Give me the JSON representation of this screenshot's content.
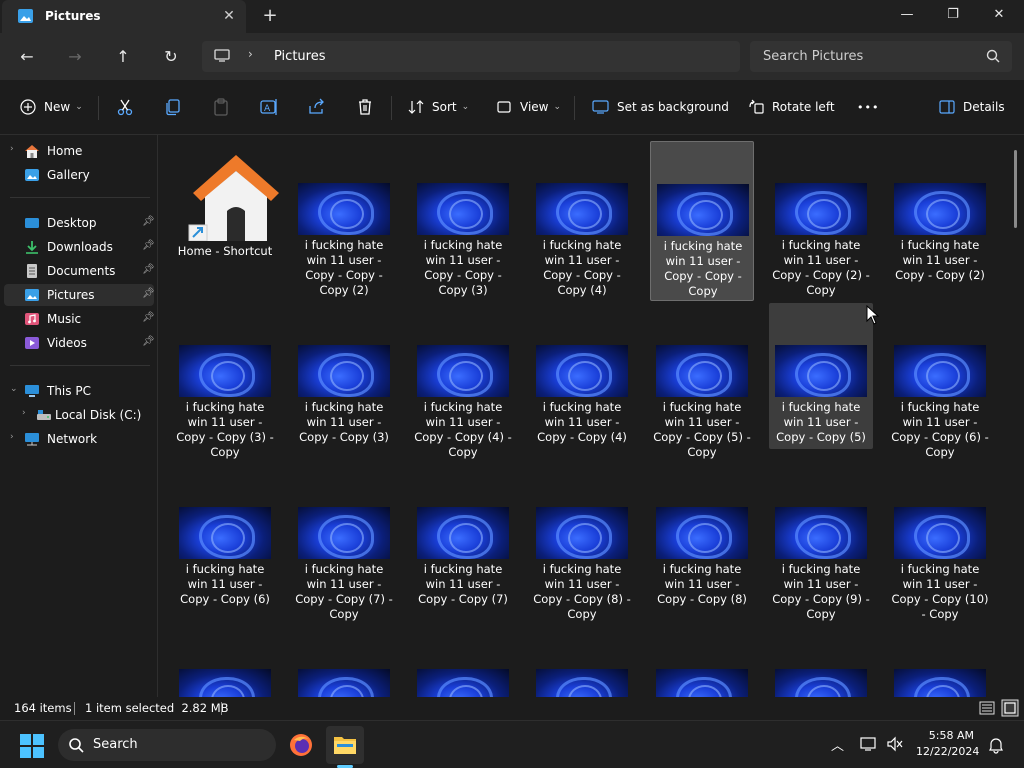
{
  "window": {
    "tab_title": "Pictures",
    "controls": {
      "minimize": "—",
      "maximize": "❐",
      "close": "✕"
    }
  },
  "nav": {
    "breadcrumb": "Pictures",
    "search_placeholder": "Search Pictures"
  },
  "commandbar": {
    "new_label": "New",
    "sort_label": "Sort",
    "view_label": "View",
    "set_bg_label": "Set as background",
    "rotate_label": "Rotate left",
    "more_label": "•••",
    "details_label": "Details"
  },
  "sidebar": {
    "items": [
      {
        "label": "Home",
        "icon": "home-icon",
        "pinned": false
      },
      {
        "label": "Gallery",
        "icon": "gallery-icon",
        "pinned": false
      },
      {
        "label": "Desktop",
        "icon": "desktop-icon",
        "pinned": true
      },
      {
        "label": "Downloads",
        "icon": "downloads-icon",
        "pinned": true
      },
      {
        "label": "Documents",
        "icon": "documents-icon",
        "pinned": true
      },
      {
        "label": "Pictures",
        "icon": "pictures-icon",
        "pinned": true,
        "selected": true
      },
      {
        "label": "Music",
        "icon": "music-icon",
        "pinned": true
      },
      {
        "label": "Videos",
        "icon": "videos-icon",
        "pinned": true
      },
      {
        "label": "This PC",
        "icon": "pc-icon",
        "pinned": false
      },
      {
        "label": "Local Disk (C:)",
        "icon": "disk-icon",
        "pinned": false
      },
      {
        "label": "Network",
        "icon": "network-icon",
        "pinned": false
      }
    ]
  },
  "files": [
    {
      "name": "Home - Shortcut",
      "type": "shortcut"
    },
    {
      "name": "i fucking hate win 11 user - Copy - Copy - Copy (2)"
    },
    {
      "name": "i fucking hate win 11 user - Copy - Copy - Copy (3)"
    },
    {
      "name": "i fucking hate win 11 user - Copy - Copy - Copy (4)"
    },
    {
      "name": "i fucking hate win 11 user - Copy - Copy - Copy",
      "selected": true
    },
    {
      "name": "i fucking hate win 11 user - Copy - Copy (2) - Copy"
    },
    {
      "name": "i fucking hate win 11 user - Copy - Copy (2)"
    },
    {
      "name": "i fucking hate win 11 user - Copy - Copy (3) - Copy"
    },
    {
      "name": "i fucking hate win 11 user - Copy - Copy (3)"
    },
    {
      "name": "i fucking hate win 11 user - Copy - Copy (4) - Copy"
    },
    {
      "name": "i fucking hate win 11 user - Copy - Copy (4)"
    },
    {
      "name": "i fucking hate win 11 user - Copy - Copy (5) - Copy"
    },
    {
      "name": "i fucking hate win 11 user - Copy - Copy (5)",
      "hover": true
    },
    {
      "name": "i fucking hate win 11 user - Copy - Copy (6) - Copy"
    },
    {
      "name": "i fucking hate win 11 user - Copy - Copy (6)"
    },
    {
      "name": "i fucking hate win 11 user - Copy - Copy (7) - Copy"
    },
    {
      "name": "i fucking hate win 11 user - Copy - Copy (7)"
    },
    {
      "name": "i fucking hate win 11 user - Copy - Copy (8) - Copy"
    },
    {
      "name": "i fucking hate win 11 user - Copy - Copy (8)"
    },
    {
      "name": "i fucking hate win 11 user - Copy - Copy (9) - Copy"
    },
    {
      "name": "i fucking hate win 11 user - Copy - Copy (10) - Copy"
    }
  ],
  "status": {
    "item_count": "164 items",
    "selection": "1 item selected  2.82 MB"
  },
  "taskbar": {
    "search_label": "Search",
    "time": "5:58 AM",
    "date": "12/22/2024"
  },
  "colors": {
    "accent": "#60cdff",
    "folder_yellow": "#f5c242",
    "selection_bg": "#4a4a4a"
  }
}
